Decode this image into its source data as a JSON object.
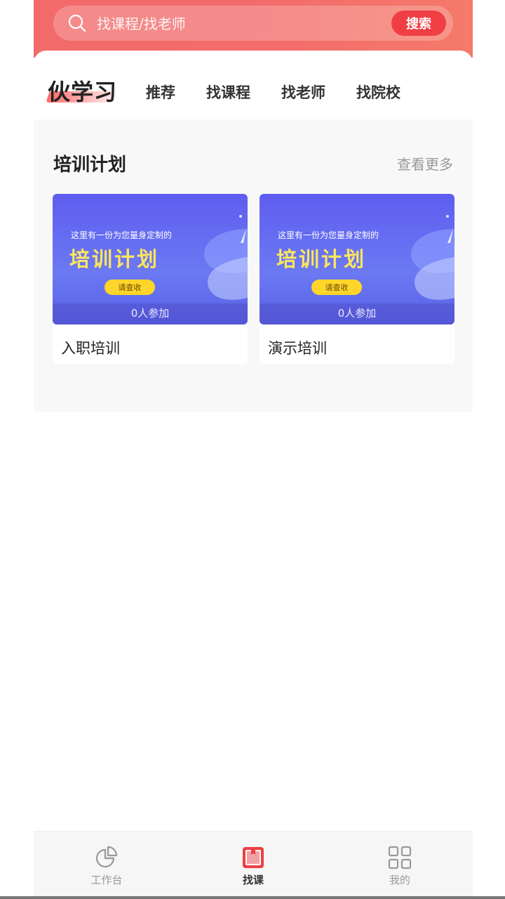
{
  "search": {
    "placeholder": "找课程/找老师",
    "button_label": "搜索"
  },
  "brand": {
    "title": "伙学习"
  },
  "nav_tabs": [
    {
      "label": "推荐"
    },
    {
      "label": "找课程"
    },
    {
      "label": "找老师"
    },
    {
      "label": "找院校"
    }
  ],
  "training_section": {
    "title": "培训计划",
    "see_more": "查看更多",
    "cards": [
      {
        "banner_sub": "这里有一份为您量身定制的",
        "banner_main": "培训计划",
        "banner_cta": "请查收",
        "participants": "0人参加",
        "title": "入职培训"
      },
      {
        "banner_sub": "这里有一份为您量身定制的",
        "banner_main": "培训计划",
        "banner_cta": "请查收",
        "participants": "0人参加",
        "title": "演示培训"
      }
    ]
  },
  "tabbar": {
    "items": [
      {
        "label": "工作台",
        "icon": "pie-chart-icon",
        "active": false
      },
      {
        "label": "找课",
        "icon": "book-icon",
        "active": true
      },
      {
        "label": "我的",
        "icon": "grid-icon",
        "active": false
      }
    ]
  },
  "colors": {
    "header_red": "#f26a6a",
    "search_button": "#ef3f45",
    "banner_blue": "#5f5df0",
    "banner_yellow": "#ffe65c",
    "active_tab_icon": "#ef3f45"
  }
}
